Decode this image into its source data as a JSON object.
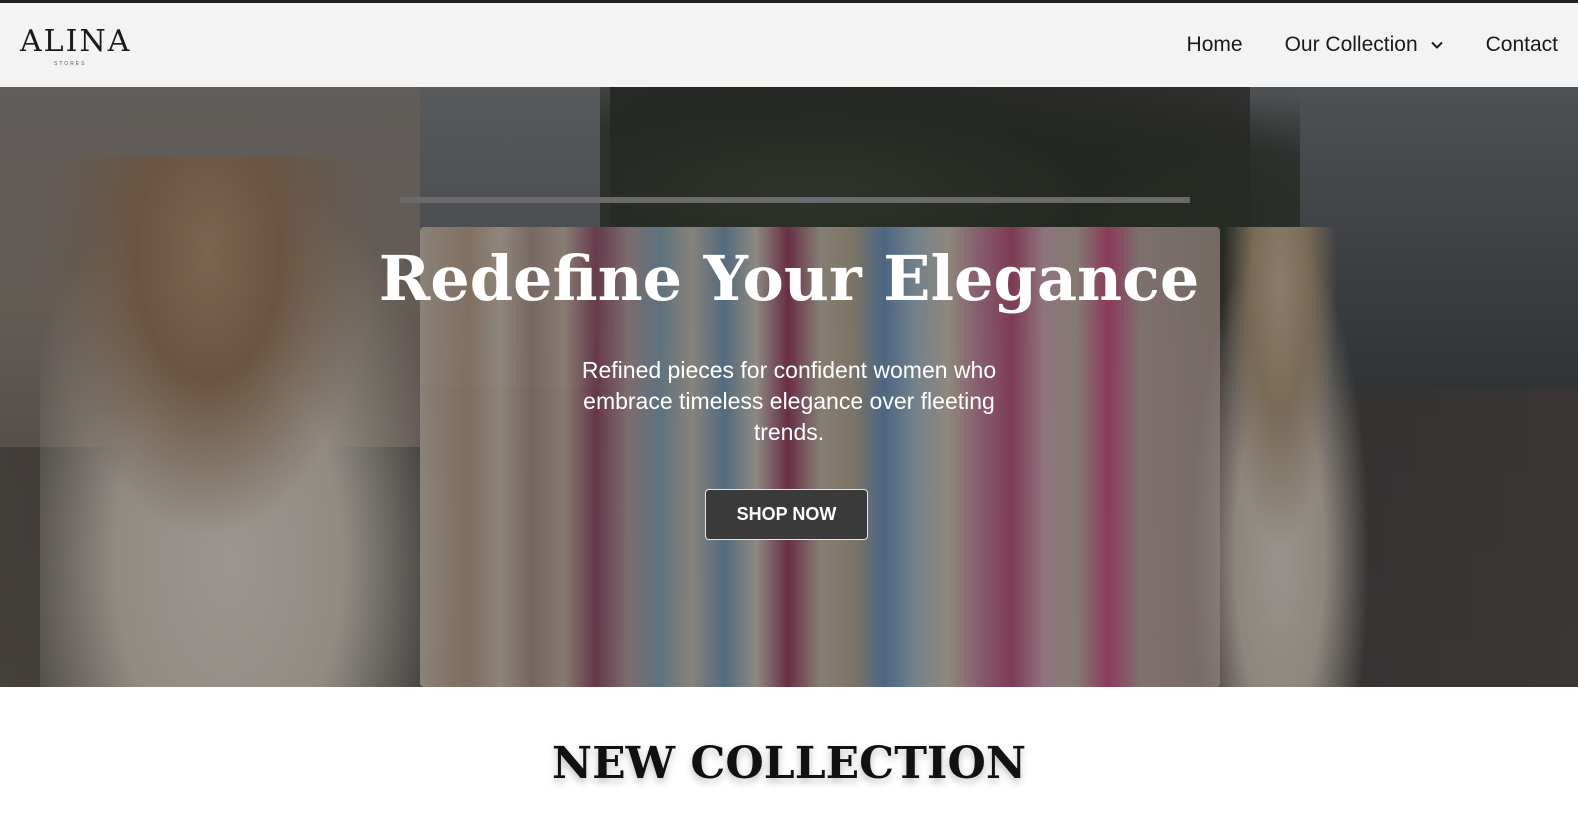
{
  "header": {
    "logo_text": "ALINA",
    "logo_subtext": "STORES",
    "nav": {
      "home": "Home",
      "collection": "Our Collection",
      "contact": "Contact"
    }
  },
  "hero": {
    "title": "Redefine Your Elegance",
    "subtitle": "Refined pieces for confident women who embrace timeless elegance over fleeting trends.",
    "cta_label": "SHOP NOW"
  },
  "section": {
    "title": "NEW COLLECTION"
  },
  "icons": {
    "collection_dropdown": "chevron-down-icon"
  },
  "colors": {
    "top_line": "#1e2328",
    "header_bg": "#f3f3f3",
    "button_bg": "#3a3a3a",
    "text_dark": "#111111"
  }
}
